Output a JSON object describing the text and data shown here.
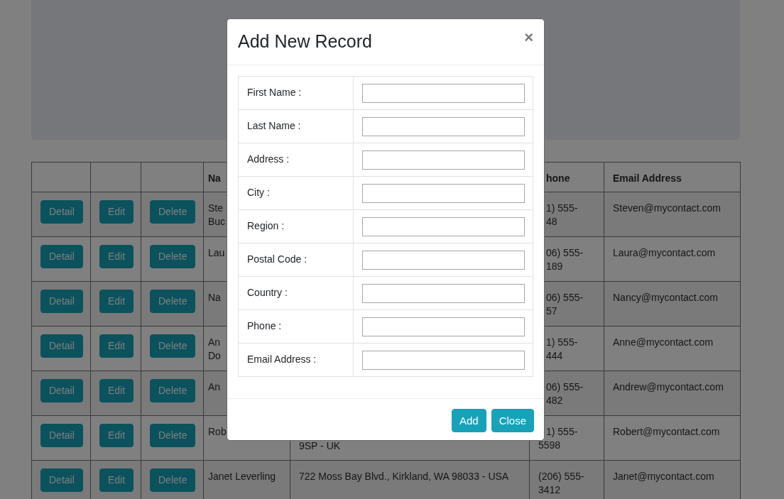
{
  "table": {
    "header": {
      "name": "Na",
      "phone": "hone",
      "email": "Email Address"
    },
    "rows": [
      {
        "actions": [
          "Detail",
          "Edit",
          "Delete"
        ],
        "name": [
          "Ste",
          "Buc"
        ],
        "phone": [
          "1) 555-",
          "48"
        ],
        "email": "Steven@mycontact.com"
      },
      {
        "actions": [
          "Detail",
          "Edit",
          "Delete"
        ],
        "name": [
          "Lau"
        ],
        "phone": [
          "06) 555-",
          "189"
        ],
        "email": "Laura@mycontact.com"
      },
      {
        "actions": [
          "Detail",
          "Edit",
          "Delete"
        ],
        "name": [
          "Na"
        ],
        "phone": [
          "06) 555-",
          "57"
        ],
        "email": "Nancy@mycontact.com"
      },
      {
        "actions": [
          "Detail",
          "Edit",
          "Delete"
        ],
        "name": [
          "An",
          "Do"
        ],
        "phone": [
          "1) 555-",
          "444"
        ],
        "email": "Anne@mycontact.com"
      },
      {
        "actions": [
          "Detail",
          "Edit",
          "Delete"
        ],
        "name": [
          "An"
        ],
        "phone": [
          "06) 555-",
          "482"
        ],
        "email": "Andrew@mycontact.com"
      },
      {
        "actions": [
          "Detail",
          "Edit",
          "Delete"
        ],
        "name": [
          "Rob"
        ],
        "address": [
          "9SP - UK"
        ],
        "phone": [
          "1) 555-",
          "5598"
        ],
        "email": "Robert@mycontact.com"
      },
      {
        "actions": [
          "Detail",
          "Edit",
          "Delete"
        ],
        "name": [
          "Janet Leverling"
        ],
        "address": [
          "722 Moss Bay Blvd., Kirkland, WA 98033 - USA"
        ],
        "phone": [
          "(206) 555-",
          "3412"
        ],
        "email": "Janet@mycontact.com"
      }
    ]
  },
  "modal": {
    "title": "Add New Record",
    "close": "×",
    "fields": [
      {
        "label": "First Name :"
      },
      {
        "label": "Last Name :"
      },
      {
        "label": "Address :"
      },
      {
        "label": "City :"
      },
      {
        "label": "Region :"
      },
      {
        "label": "Postal Code :"
      },
      {
        "label": "Country :"
      },
      {
        "label": "Phone :"
      },
      {
        "label": "Email Address :"
      }
    ],
    "buttons": [
      "Add",
      "Close"
    ]
  }
}
